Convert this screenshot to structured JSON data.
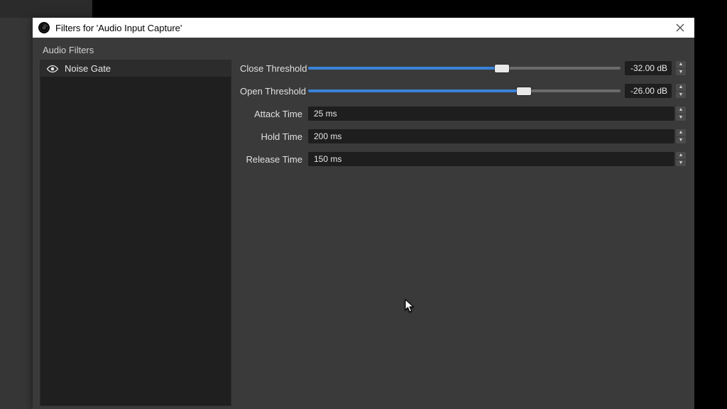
{
  "window": {
    "title": "Filters for 'Audio Input Capture'"
  },
  "sidebar": {
    "heading": "Audio Filters",
    "filters": [
      {
        "name": "Noise Gate",
        "visible": true
      }
    ]
  },
  "properties": {
    "close_threshold": {
      "label": "Close Threshold",
      "value_text": "-32.00 dB",
      "fill_pct": 62,
      "thumb_pct": 62
    },
    "open_threshold": {
      "label": "Open Threshold",
      "value_text": "-26.00 dB",
      "fill_pct": 69,
      "thumb_pct": 69
    },
    "attack_time": {
      "label": "Attack Time",
      "value_text": "25 ms"
    },
    "hold_time": {
      "label": "Hold Time",
      "value_text": "200 ms"
    },
    "release_time": {
      "label": "Release Time",
      "value_text": "150 ms"
    }
  }
}
